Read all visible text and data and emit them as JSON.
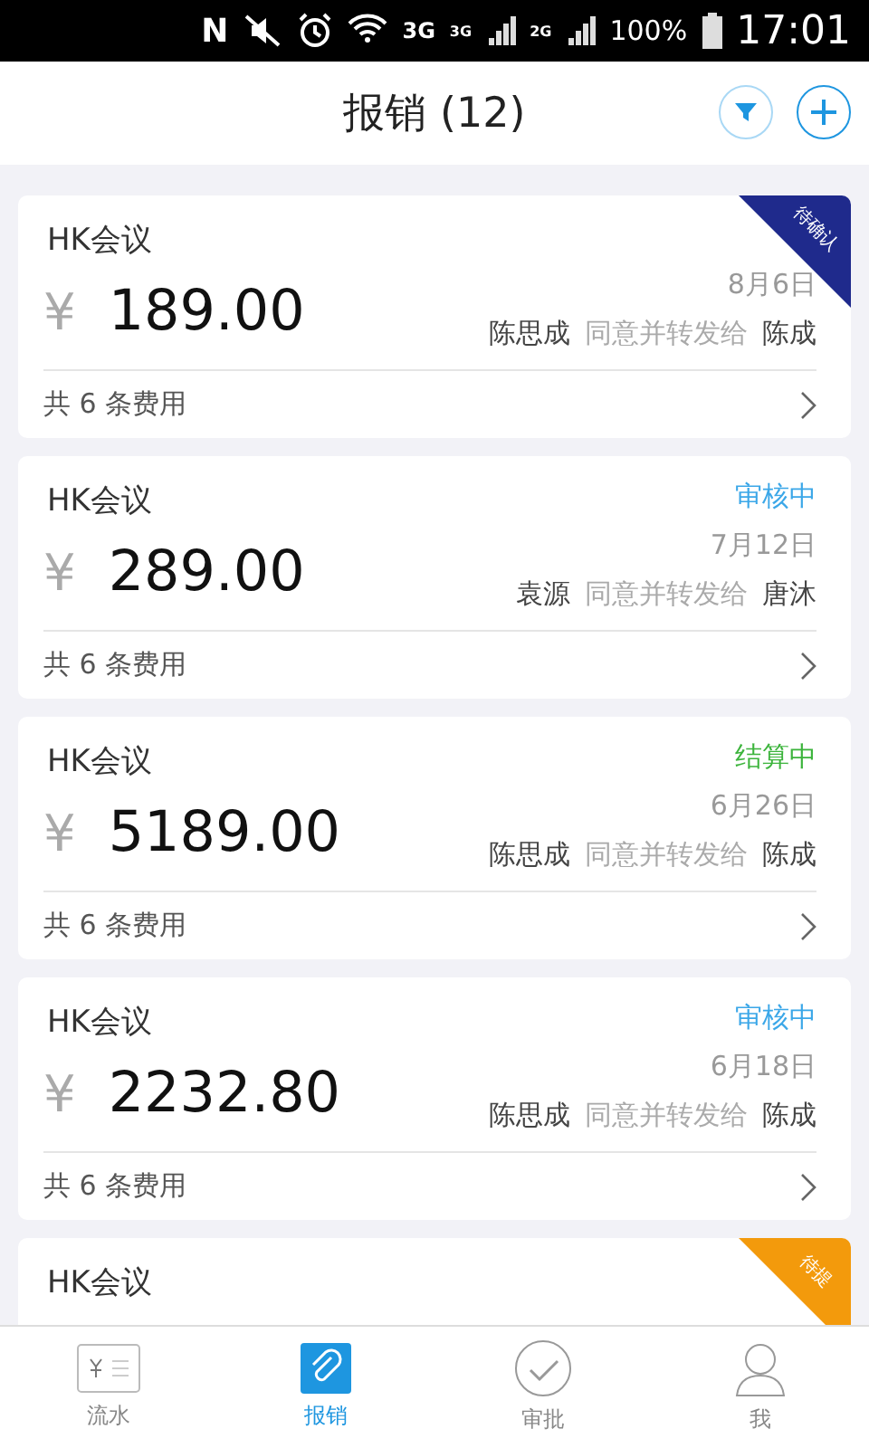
{
  "status_bar": {
    "nfc": "N",
    "network": "3G",
    "signal_1": "3G",
    "signal_2": "2G",
    "battery": "100%",
    "time": "17:01"
  },
  "header": {
    "title": "报销 (12)"
  },
  "cards": [
    {
      "title": "HK会议",
      "currency": "¥",
      "amount": "189.00",
      "date": "8月6日",
      "from": "陈思成",
      "action": "同意并转发给",
      "to": "陈成",
      "footer": "共 6 条费用",
      "status": {
        "kind": "ribbon",
        "label": "待确认",
        "color": "#1f2a8c"
      }
    },
    {
      "title": "HK会议",
      "currency": "¥",
      "amount": "289.00",
      "date": "7月12日",
      "from": "袁源",
      "action": "同意并转发给",
      "to": "唐沐",
      "footer": "共 6 条费用",
      "status": {
        "kind": "text",
        "label": "审核中",
        "color": "#3ba7e8"
      }
    },
    {
      "title": "HK会议",
      "currency": "¥",
      "amount": "5189.00",
      "date": "6月26日",
      "from": "陈思成",
      "action": "同意并转发给",
      "to": "陈成",
      "footer": "共 6 条费用",
      "status": {
        "kind": "text",
        "label": "结算中",
        "color": "#3cb43c"
      }
    },
    {
      "title": "HK会议",
      "currency": "¥",
      "amount": "2232.80",
      "date": "6月18日",
      "from": "陈思成",
      "action": "同意并转发给",
      "to": "陈成",
      "footer": "共 6 条费用",
      "status": {
        "kind": "text",
        "label": "审核中",
        "color": "#3ba7e8"
      }
    },
    {
      "title": "HK会议",
      "status": {
        "kind": "ribbon",
        "label": "待提",
        "color": "#f39a0c"
      }
    }
  ],
  "tab_bar": [
    {
      "kind": "ledger",
      "label": "流水",
      "selected": false
    },
    {
      "kind": "clip",
      "label": "报销",
      "selected": true
    },
    {
      "kind": "check",
      "label": "审批",
      "selected": false
    },
    {
      "kind": "person",
      "label": "我",
      "selected": false
    }
  ]
}
